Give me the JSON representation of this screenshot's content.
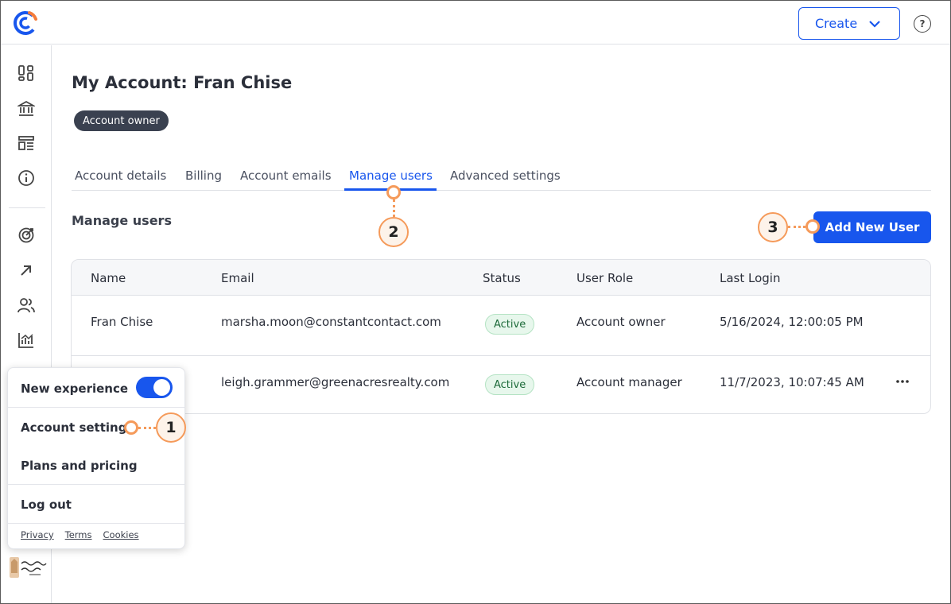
{
  "header": {
    "logo_icon": "constant-contact-logo-icon",
    "create_label": "Create",
    "help_glyph": "?"
  },
  "rail": {
    "icons": [
      "dashboard-icon",
      "bank-icon",
      "layout-icon",
      "info-icon",
      "target-icon",
      "arrow-up-right-icon",
      "users-icon",
      "chart-icon"
    ],
    "brand_logo": "green-acres-realty-logo"
  },
  "page": {
    "title": "My Account: Fran Chise",
    "badge": "Account owner"
  },
  "tabs": [
    {
      "label": "Account details",
      "active": false
    },
    {
      "label": "Billing",
      "active": false
    },
    {
      "label": "Account emails",
      "active": false
    },
    {
      "label": "Manage users",
      "active": true
    },
    {
      "label": "Advanced settings",
      "active": false
    }
  ],
  "manage": {
    "section_title": "Manage users",
    "add_button_label": "Add New User"
  },
  "table": {
    "columns": [
      "Name",
      "Email",
      "Status",
      "User Role",
      "Last Login"
    ],
    "rows": [
      {
        "name": "Fran Chise",
        "email": "marsha.moon@constantcontact.com",
        "status": "Active",
        "role": "Account owner",
        "last_login": "5/16/2024, 12:00:05 PM"
      },
      {
        "name": "",
        "email": "leigh.grammer@greenacresrealty.com",
        "status": "Active",
        "role": "Account manager",
        "last_login": "11/7/2023, 10:07:45 AM"
      }
    ]
  },
  "menu": {
    "new_experience_label": "New experience",
    "new_experience_on": true,
    "account_settings_label": "Account settings",
    "plans_label": "Plans and pricing",
    "logout_label": "Log out",
    "links": [
      "Privacy",
      "Terms",
      "Cookies"
    ]
  },
  "callouts": [
    "1",
    "2",
    "3"
  ],
  "colors": {
    "accent": "#1856ed",
    "callout": "#f59a5a",
    "badge_bg": "#3a4150",
    "active_green": "#1d6b3a"
  }
}
